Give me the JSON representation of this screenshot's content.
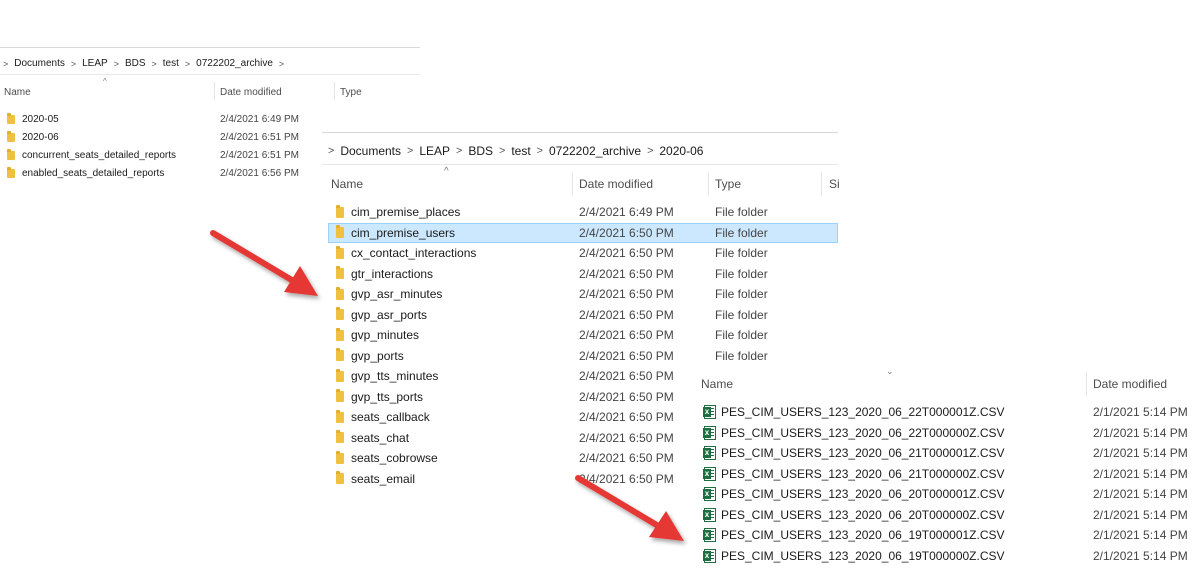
{
  "panel1": {
    "breadcrumb": [
      "Documents",
      "LEAP",
      "BDS",
      "test",
      "0722202_archive"
    ],
    "columns": {
      "name": "Name",
      "date": "Date modified",
      "type": "Type"
    },
    "rows": [
      {
        "name": "2020-05",
        "date": "2/4/2021 6:49 PM"
      },
      {
        "name": "2020-06",
        "date": "2/4/2021 6:51 PM"
      },
      {
        "name": "concurrent_seats_detailed_reports",
        "date": "2/4/2021 6:51 PM"
      },
      {
        "name": "enabled_seats_detailed_reports",
        "date": "2/4/2021 6:56 PM"
      }
    ]
  },
  "panel2": {
    "breadcrumb": [
      "Documents",
      "LEAP",
      "BDS",
      "test",
      "0722202_archive",
      "2020-06"
    ],
    "columns": {
      "name": "Name",
      "date": "Date modified",
      "type": "Type",
      "size": "Si"
    },
    "rows": [
      {
        "name": "cim_premise_places",
        "date": "2/4/2021 6:49 PM",
        "type": "File folder"
      },
      {
        "name": "cim_premise_users",
        "date": "2/4/2021 6:50 PM",
        "type": "File folder",
        "selected": true
      },
      {
        "name": "cx_contact_interactions",
        "date": "2/4/2021 6:50 PM",
        "type": "File folder"
      },
      {
        "name": "gtr_interactions",
        "date": "2/4/2021 6:50 PM",
        "type": "File folder"
      },
      {
        "name": "gvp_asr_minutes",
        "date": "2/4/2021 6:50 PM",
        "type": "File folder"
      },
      {
        "name": "gvp_asr_ports",
        "date": "2/4/2021 6:50 PM",
        "type": "File folder"
      },
      {
        "name": "gvp_minutes",
        "date": "2/4/2021 6:50 PM",
        "type": "File folder"
      },
      {
        "name": "gvp_ports",
        "date": "2/4/2021 6:50 PM",
        "type": "File folder"
      },
      {
        "name": "gvp_tts_minutes",
        "date": "2/4/2021 6:50 PM",
        "type": ""
      },
      {
        "name": "gvp_tts_ports",
        "date": "2/4/2021 6:50 PM",
        "type": ""
      },
      {
        "name": "seats_callback",
        "date": "2/4/2021 6:50 PM",
        "type": ""
      },
      {
        "name": "seats_chat",
        "date": "2/4/2021 6:50 PM",
        "type": ""
      },
      {
        "name": "seats_cobrowse",
        "date": "2/4/2021 6:50 PM",
        "type": ""
      },
      {
        "name": "seats_email",
        "date": "2/4/2021 6:50 PM",
        "type": ""
      }
    ]
  },
  "panel3": {
    "columns": {
      "name": "Name",
      "date": "Date modified"
    },
    "rows": [
      {
        "name": "PES_CIM_USERS_123_2020_06_22T000001Z.CSV",
        "date": "2/1/2021 5:14 PM"
      },
      {
        "name": "PES_CIM_USERS_123_2020_06_22T000000Z.CSV",
        "date": "2/1/2021 5:14 PM"
      },
      {
        "name": "PES_CIM_USERS_123_2020_06_21T000001Z.CSV",
        "date": "2/1/2021 5:14 PM"
      },
      {
        "name": "PES_CIM_USERS_123_2020_06_21T000000Z.CSV",
        "date": "2/1/2021 5:14 PM"
      },
      {
        "name": "PES_CIM_USERS_123_2020_06_20T000001Z.CSV",
        "date": "2/1/2021 5:14 PM"
      },
      {
        "name": "PES_CIM_USERS_123_2020_06_20T000000Z.CSV",
        "date": "2/1/2021 5:14 PM"
      },
      {
        "name": "PES_CIM_USERS_123_2020_06_19T000001Z.CSV",
        "date": "2/1/2021 5:14 PM"
      },
      {
        "name": "PES_CIM_USERS_123_2020_06_19T000000Z.CSV",
        "date": "2/1/2021 5:14 PM"
      }
    ]
  },
  "icons": {
    "folder": "folder-icon",
    "csv": "excel-csv-icon",
    "arrow": "red-arrow-icon"
  },
  "colors": {
    "folder": "#f0c040",
    "selected_row": "#cce8ff",
    "arrow": "#e53935",
    "excel": "#1d6f42"
  }
}
